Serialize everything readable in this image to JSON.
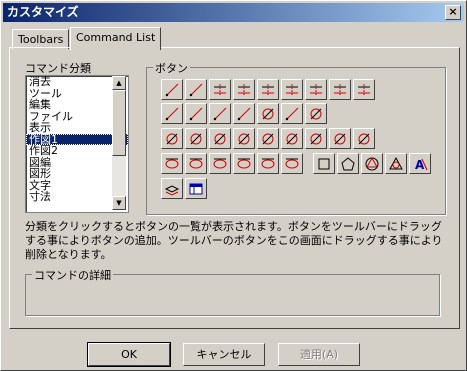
{
  "window": {
    "title": "カスタマイズ",
    "close_glyph": "×"
  },
  "tabs": [
    {
      "label": "Toolbars"
    },
    {
      "label": "Command List"
    }
  ],
  "categories": {
    "label": "コマンド分類",
    "items": [
      "消去",
      "ツール",
      "編集",
      "ファイル",
      "表示",
      "作図1",
      "作図2",
      "図編",
      "図形",
      "文字",
      "寸法"
    ],
    "selected": "作図1"
  },
  "buttons_group": {
    "label": "ボタン",
    "rows": [
      [
        "line-icon",
        "angled-line-icon",
        "parallel-line-icon",
        "multi-parallel-line-icon",
        "dashed-parallel-icon",
        "vertical-offset-icon",
        "vertical-offset-alt-icon",
        "grid-snap-icon",
        "grid-snap-alt-icon"
      ],
      [
        "tangent-line-icon",
        "bisector-icon",
        "intersection-line-icon",
        "perpendicular-line-icon",
        "circle-tangent-icon",
        "percent-division-icon",
        "circle-line-icon"
      ],
      [
        "circle-icon",
        "concentric-circle-icon",
        "square-circle-icon",
        "circle-arc-icon",
        "fillet-icon",
        "dome-arc-icon",
        "arc-icon",
        "arc-chord-icon",
        "arc-triangle-icon"
      ],
      [
        "ellipse-icon",
        "ellipse-rect-icon",
        "ellipse-center-icon",
        "elliptic-arc-icon",
        "ellipse-polygon-icon",
        "ellipse-arc-point-icon",
        "rectangle-icon",
        "pentagon-icon",
        "polygon-circle-icon",
        "triangle-circle-icon",
        "text-style-icon"
      ],
      [
        "layer-stack-icon",
        "table-icon"
      ]
    ]
  },
  "description": "分類をクリックするとボタンの一覧が表示されます。ボタンをツールバーにドラッグする事によりボタンの追加。ツールバーのボタンをこの画面にドラッグする事により削除となります。",
  "details": {
    "label": "コマンドの詳細",
    "text": ""
  },
  "dialog_buttons": {
    "ok": "OK",
    "cancel": "キャンセル",
    "apply": "適用(A)"
  },
  "colors": {
    "accent": "#0a246a",
    "icon_red": "#cc0000",
    "icon_blue": "#0000aa"
  }
}
